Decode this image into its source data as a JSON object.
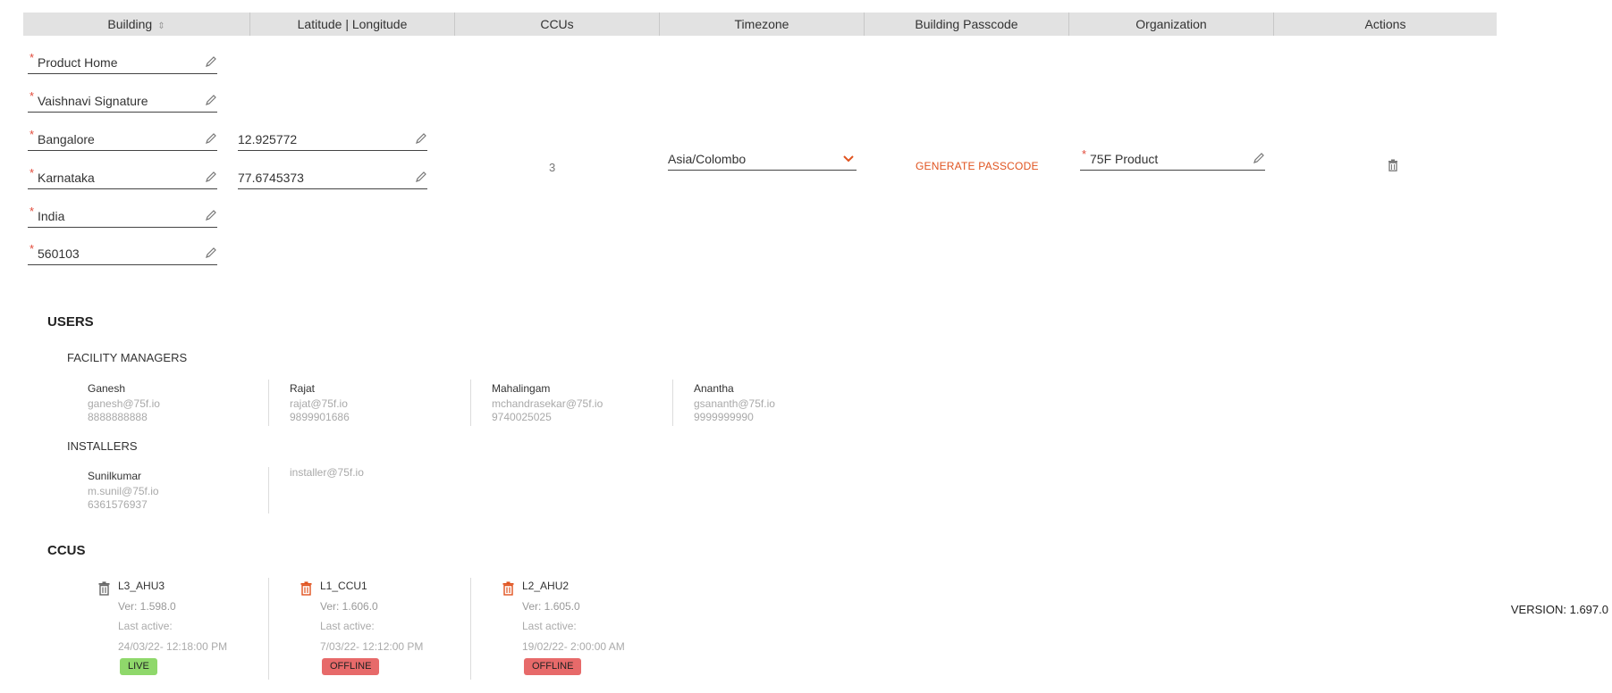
{
  "header": {
    "columns": [
      "Building",
      "Latitude | Longitude",
      "CCUs",
      "Timezone",
      "Building Passcode",
      "Organization",
      "Actions"
    ]
  },
  "building": {
    "name": "Product Home",
    "address": "Vaishnavi Signature",
    "city": "Bangalore",
    "state": "Karnataka",
    "country": "India",
    "zip": "560103",
    "latitude": "12.925772",
    "longitude": "77.6745373",
    "ccu_count": "3",
    "timezone": "Asia/Colombo",
    "generate_passcode_label": "GENERATE PASSCODE",
    "organization": "75F Product",
    "required_marker": "*"
  },
  "users": {
    "title": "USERS",
    "facility_managers_title": "FACILITY MANAGERS",
    "facility_managers": [
      {
        "name": "Ganesh",
        "email": "ganesh@75f.io",
        "phone": "8888888888"
      },
      {
        "name": "Rajat",
        "email": "rajat@75f.io",
        "phone": "9899901686"
      },
      {
        "name": "Mahalingam",
        "email": "mchandrasekar@75f.io",
        "phone": "9740025025"
      },
      {
        "name": "Anantha",
        "email": "gsananth@75f.io",
        "phone": "9999999990"
      }
    ],
    "installers_title": "INSTALLERS",
    "installers": [
      {
        "name": "Sunilkumar",
        "email": "m.sunil@75f.io",
        "phone": "6361576937"
      },
      {
        "name": "",
        "email": "installer@75f.io",
        "phone": ""
      }
    ]
  },
  "ccus": {
    "title": "CCUS",
    "last_active_label": "Last active:",
    "items": [
      {
        "name": "L3_AHU3",
        "version": "Ver: 1.598.0",
        "last_active": "24/03/22- 12:18:00 PM",
        "status": "LIVE",
        "icon_color": "#666666"
      },
      {
        "name": "L1_CCU1",
        "version": "Ver: 1.606.0",
        "last_active": "7/03/22- 12:12:00 PM",
        "status": "OFFLINE",
        "icon_color": "#e0531f"
      },
      {
        "name": "L2_AHU2",
        "version": "Ver: 1.605.0",
        "last_active": "19/02/22- 2:00:00 AM",
        "status": "OFFLINE",
        "icon_color": "#e0531f"
      }
    ]
  },
  "footer": {
    "version": "VERSION: 1.697.0"
  },
  "colors": {
    "accent": "#e0531f",
    "live": "#8fd86b",
    "offline": "#e76a6a",
    "required": "#e24b3b"
  },
  "icons": {
    "edit": "pencil-icon",
    "delete": "trash-icon",
    "dropdown": "chevron-down-icon",
    "sort": "sort-icon"
  }
}
